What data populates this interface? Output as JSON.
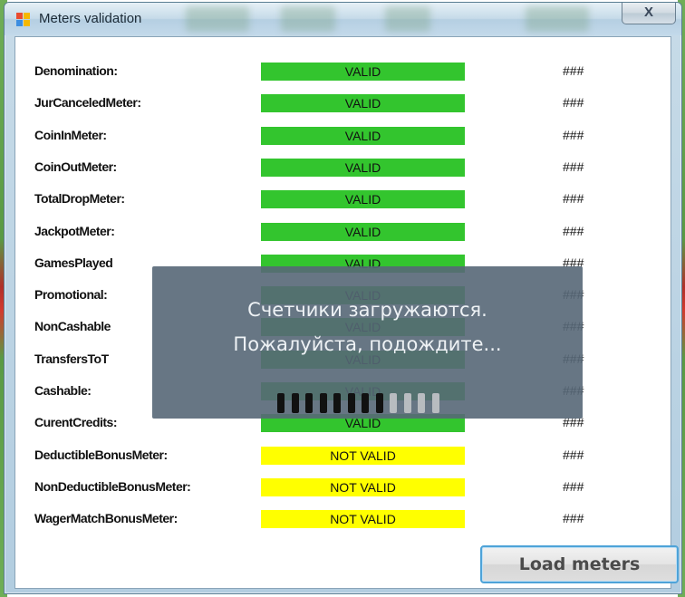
{
  "window": {
    "title": "Meters validation",
    "close_glyph": "X",
    "icon": "window-app-icon"
  },
  "colors": {
    "valid": "#33c52e",
    "not_valid": "#ffff00",
    "overlay": "#576777",
    "spinner_on": "#111111",
    "spinner_off": "#b8bcc0"
  },
  "meters": [
    {
      "label": "Denomination:",
      "status": "VALID",
      "value": "###"
    },
    {
      "label": "JurCanceledMeter:",
      "status": "VALID",
      "value": "###"
    },
    {
      "label": "CoinInMeter:",
      "status": "VALID",
      "value": "###"
    },
    {
      "label": "CoinOutMeter:",
      "status": "VALID",
      "value": "###"
    },
    {
      "label": "TotalDropMeter:",
      "status": "VALID",
      "value": "###"
    },
    {
      "label": "JackpotMeter:",
      "status": "VALID",
      "value": "###"
    },
    {
      "label": "GamesPlayed",
      "status": "VALID",
      "value": "###"
    },
    {
      "label": "Promotional:",
      "status": "VALID",
      "value": "###"
    },
    {
      "label": "NonCashable",
      "status": "VALID",
      "value": "###"
    },
    {
      "label": "TransfersToT",
      "status": "VALID",
      "value": "###"
    },
    {
      "label": "Cashable:",
      "status": "VALID",
      "value": "###"
    },
    {
      "label": "CurentCredits:",
      "status": "VALID",
      "value": "###"
    },
    {
      "label": "DeductibleBonusMeter:",
      "status": "NOT VALID",
      "value": "###"
    },
    {
      "label": "NonDeductibleBonusMeter:",
      "status": "NOT VALID",
      "value": "###"
    },
    {
      "label": "WagerMatchBonusMeter:",
      "status": "NOT VALID",
      "value": "###"
    }
  ],
  "load_button": {
    "label": "Load meters"
  },
  "loading_overlay": {
    "line1": "Счетчики загружаются.",
    "line2": "Пожалуйста, подождите...",
    "segments_total": 12,
    "segments_filled": 8
  }
}
